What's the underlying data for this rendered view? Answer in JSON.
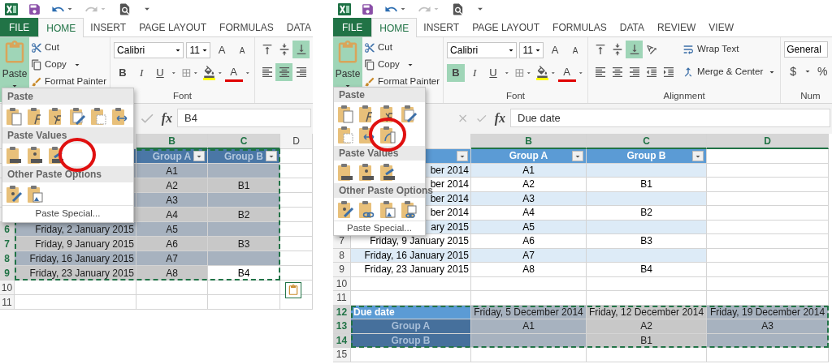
{
  "panels": [
    {
      "tabs": [
        {
          "label": "FILE",
          "kind": "file",
          "selected": false
        },
        {
          "label": "HOME",
          "kind": "tab",
          "selected": true
        },
        {
          "label": "INSERT",
          "kind": "tab",
          "selected": false
        },
        {
          "label": "PAGE LAYOUT",
          "kind": "tab",
          "selected": false
        },
        {
          "label": "FORMULAS",
          "kind": "tab",
          "selected": false
        },
        {
          "label": "DATA",
          "kind": "tab",
          "selected": false
        }
      ],
      "ribbon": {
        "clipboard": {
          "paste": "Paste",
          "paste_open": true,
          "cut": "Cut",
          "copy": "Copy",
          "format_painter": "Format Painter"
        },
        "font": {
          "name": "Calibri",
          "size": "11",
          "grow": "A",
          "shrink": "A",
          "bold": "B",
          "bold_on": false,
          "italic": "I",
          "underline": "U",
          "font_color": "A",
          "label": "Font"
        },
        "alignment": {
          "rows": [
            [
              {
                "kind": "top",
                "selected": false
              },
              {
                "kind": "middle",
                "selected": false
              },
              {
                "kind": "bottom",
                "selected": true
              }
            ],
            [
              {
                "kind": "left",
                "selected": false
              },
              {
                "kind": "center",
                "selected": true
              },
              {
                "kind": "right",
                "selected": false
              }
            ]
          ]
        }
      },
      "paste_menu": {
        "sections": [
          {
            "title": "Paste",
            "items": [
              {
                "kind": "all",
                "circled": false
              },
              {
                "kind": "formulas",
                "circled": false
              },
              {
                "kind": "formulas-number",
                "circled": false
              },
              {
                "kind": "keep-source",
                "circled": false
              },
              {
                "kind": "no-borders",
                "circled": false
              },
              {
                "kind": "keep-widths",
                "circled": false
              }
            ]
          },
          {
            "title": "Paste Values",
            "circled_gap": true,
            "items": [
              {
                "kind": "values",
                "circled": false
              },
              {
                "kind": "values-number",
                "circled": false
              },
              {
                "kind": "values-source",
                "circled": false
              }
            ]
          },
          {
            "title": "Other Paste Options",
            "items": [
              {
                "kind": "formatting",
                "circled": false
              },
              {
                "kind": "picture",
                "circled": false
              }
            ]
          }
        ],
        "footer": "Paste Special..."
      },
      "formula_bar": {
        "buttons": [
          {
            "kind": "enter"
          },
          {
            "kind": "function",
            "label": "fx"
          }
        ],
        "value": "B4"
      },
      "grid": {
        "columns": [
          {
            "label": "B",
            "highlighted": true
          },
          {
            "label": "C",
            "highlighted": true
          },
          {
            "label": "D",
            "highlighted": false
          }
        ],
        "paste_options_button": true,
        "sections": [
          {
            "copied": true,
            "rows": [
              {
                "cells": [
                  {
                    "kind": "sel-header"
                  },
                  {
                    "kind": "sel-header",
                    "text": "Group A",
                    "filter": true
                  },
                  {
                    "kind": "sel-header",
                    "text": "Group B",
                    "filter": true
                  }
                ],
                "outside": [
                  {
                    "kind": "empty"
                  }
                ]
              },
              {
                "cells": [
                  {
                    "kind": "sel-band"
                  },
                  {
                    "kind": "sel-band",
                    "text": "A1"
                  },
                  {
                    "kind": "sel-band"
                  }
                ],
                "outside": [
                  {
                    "kind": "empty"
                  }
                ]
              },
              {
                "cells": [
                  {
                    "kind": "sel-plain"
                  },
                  {
                    "kind": "sel-plain",
                    "text": "A2"
                  },
                  {
                    "kind": "sel-plain",
                    "text": "B1"
                  }
                ],
                "outside": [
                  {
                    "kind": "empty"
                  }
                ]
              },
              {
                "cells": [
                  {
                    "kind": "sel-band"
                  },
                  {
                    "kind": "sel-band",
                    "text": "A3"
                  },
                  {
                    "kind": "sel-band"
                  }
                ],
                "outside": [
                  {
                    "kind": "empty"
                  }
                ]
              },
              {
                "cells": [
                  {
                    "kind": "sel-plain"
                  },
                  {
                    "kind": "sel-plain",
                    "text": "A4"
                  },
                  {
                    "kind": "sel-plain",
                    "text": "B2"
                  }
                ],
                "outside": [
                  {
                    "kind": "empty"
                  }
                ]
              },
              {
                "number": "6",
                "highlighted": true,
                "cells": [
                  {
                    "kind": "sel-band",
                    "text": "Friday, 2 January 2015"
                  },
                  {
                    "kind": "sel-band",
                    "text": "A5"
                  },
                  {
                    "kind": "sel-band"
                  }
                ],
                "outside": [
                  {
                    "kind": "empty"
                  }
                ]
              },
              {
                "number": "7",
                "highlighted": true,
                "cells": [
                  {
                    "kind": "sel-plain",
                    "text": "Friday, 9 January 2015"
                  },
                  {
                    "kind": "sel-plain",
                    "text": "A6"
                  },
                  {
                    "kind": "sel-plain",
                    "text": "B3"
                  }
                ],
                "outside": [
                  {
                    "kind": "empty"
                  }
                ]
              },
              {
                "number": "8",
                "highlighted": true,
                "cells": [
                  {
                    "kind": "sel-band",
                    "text": "Friday, 16 January 2015"
                  },
                  {
                    "kind": "sel-band",
                    "text": "A7"
                  },
                  {
                    "kind": "sel-band"
                  }
                ],
                "outside": [
                  {
                    "kind": "empty"
                  }
                ]
              },
              {
                "number": "9",
                "highlighted": true,
                "cells": [
                  {
                    "kind": "sel-plain",
                    "text": "Friday, 23 January 2015"
                  },
                  {
                    "kind": "sel-plain",
                    "text": "A8"
                  },
                  {
                    "kind": "active",
                    "text": "B4"
                  }
                ],
                "outside": [
                  {
                    "kind": "empty"
                  }
                ]
              }
            ]
          },
          {
            "copied": false,
            "rows": [
              {
                "number": "10",
                "highlighted": false,
                "cells": [
                  {
                    "kind": "empty"
                  },
                  {
                    "kind": "empty"
                  },
                  {
                    "kind": "empty"
                  },
                  {
                    "kind": "empty"
                  }
                ]
              },
              {
                "number": "11",
                "highlighted": false,
                "cells": [
                  {
                    "kind": "empty"
                  },
                  {
                    "kind": "empty"
                  },
                  {
                    "kind": "empty"
                  },
                  {
                    "kind": "empty"
                  }
                ]
              }
            ]
          }
        ]
      }
    },
    {
      "tabs": [
        {
          "label": "FILE",
          "kind": "file",
          "selected": false
        },
        {
          "label": "HOME",
          "kind": "tab",
          "selected": true
        },
        {
          "label": "INSERT",
          "kind": "tab",
          "selected": false
        },
        {
          "label": "PAGE LAYOUT",
          "kind": "tab",
          "selected": false
        },
        {
          "label": "FORMULAS",
          "kind": "tab",
          "selected": false
        },
        {
          "label": "DATA",
          "kind": "tab",
          "selected": false
        },
        {
          "label": "REVIEW",
          "kind": "tab",
          "selected": false
        },
        {
          "label": "VIEW",
          "kind": "tab",
          "selected": false
        }
      ],
      "ribbon": {
        "clipboard": {
          "paste": "Paste",
          "paste_open": true,
          "cut": "Cut",
          "copy": "Copy",
          "format_painter": "Format Painter"
        },
        "font": {
          "name": "Calibri",
          "size": "11",
          "grow": "A",
          "shrink": "A",
          "bold": "B",
          "bold_on": true,
          "italic": "I",
          "underline": "U",
          "font_color": "A",
          "label": "Font"
        },
        "alignment": {
          "rows": [
            [
              {
                "kind": "top",
                "selected": false
              },
              {
                "kind": "middle",
                "selected": false
              },
              {
                "kind": "bottom",
                "selected": true
              },
              {
                "kind": "orientation",
                "selected": false
              }
            ],
            [
              {
                "kind": "left",
                "selected": false
              },
              {
                "kind": "center",
                "selected": false
              },
              {
                "kind": "right",
                "selected": false
              },
              {
                "kind": "indent-less",
                "selected": false
              },
              {
                "kind": "indent-more",
                "selected": false
              }
            ]
          ],
          "wrap_text": "Wrap Text",
          "merge_center": "Merge & Center",
          "label": "Alignment"
        },
        "number": {
          "format": "General",
          "currency": "$",
          "percent": "%",
          "label": "Num"
        }
      },
      "paste_menu": {
        "sections": [
          {
            "title": "Paste",
            "items": [
              {
                "kind": "all",
                "circled": false
              },
              {
                "kind": "formulas",
                "circled": false
              },
              {
                "kind": "formulas-number",
                "circled": false
              },
              {
                "kind": "keep-source",
                "circled": false
              },
              {
                "kind": "no-borders",
                "circled": false
              },
              {
                "kind": "keep-widths",
                "circled": false
              },
              {
                "kind": "transpose",
                "circled": true
              }
            ]
          },
          {
            "title": "Paste Values",
            "items": [
              {
                "kind": "values",
                "circled": false
              },
              {
                "kind": "values-number",
                "circled": false
              },
              {
                "kind": "values-source",
                "circled": false
              }
            ]
          },
          {
            "title": "Other Paste Options",
            "items": [
              {
                "kind": "formatting",
                "circled": false
              },
              {
                "kind": "link",
                "circled": false
              },
              {
                "kind": "picture",
                "circled": false
              },
              {
                "kind": "linked-picture",
                "circled": false
              }
            ]
          }
        ],
        "footer": "Paste Special..."
      },
      "formula_bar": {
        "buttons": [
          {
            "kind": "cancel"
          },
          {
            "kind": "enter"
          },
          {
            "kind": "function",
            "label": "fx"
          }
        ],
        "value": "Due date"
      },
      "grid": {
        "columns": [
          {
            "label": "B",
            "highlighted": true
          },
          {
            "label": "C",
            "highlighted": true
          },
          {
            "label": "D",
            "highlighted": true
          }
        ],
        "paste_options_button": false,
        "sections": [
          {
            "copied": false,
            "rows": [
              {
                "cells": [
                  {
                    "kind": "header",
                    "filter": true
                  },
                  {
                    "kind": "header",
                    "text": "Group A",
                    "filter": true
                  },
                  {
                    "kind": "header",
                    "text": "Group B",
                    "filter": true
                  },
                  {
                    "kind": "empty"
                  }
                ]
              },
              {
                "cells": [
                  {
                    "kind": "band",
                    "text": "ber 2014"
                  },
                  {
                    "kind": "band",
                    "text": "A1"
                  },
                  {
                    "kind": "band"
                  },
                  {
                    "kind": "empty"
                  }
                ]
              },
              {
                "cells": [
                  {
                    "kind": "plain",
                    "text": "ber 2014"
                  },
                  {
                    "kind": "plain",
                    "text": "A2"
                  },
                  {
                    "kind": "plain",
                    "text": "B1"
                  },
                  {
                    "kind": "empty"
                  }
                ]
              },
              {
                "cells": [
                  {
                    "kind": "band",
                    "text": "ber 2014"
                  },
                  {
                    "kind": "band",
                    "text": "A3"
                  },
                  {
                    "kind": "band"
                  },
                  {
                    "kind": "empty"
                  }
                ]
              },
              {
                "cells": [
                  {
                    "kind": "plain",
                    "text": "ber 2014"
                  },
                  {
                    "kind": "plain",
                    "text": "A4"
                  },
                  {
                    "kind": "plain",
                    "text": "B2"
                  },
                  {
                    "kind": "empty"
                  }
                ]
              },
              {
                "cells": [
                  {
                    "kind": "band",
                    "text": "ary 2015"
                  },
                  {
                    "kind": "band",
                    "text": "A5"
                  },
                  {
                    "kind": "band"
                  },
                  {
                    "kind": "empty"
                  }
                ]
              },
              {
                "number": "7",
                "highlighted": false,
                "cells": [
                  {
                    "kind": "plain",
                    "text": "Friday, 9 January 2015"
                  },
                  {
                    "kind": "plain",
                    "text": "A6"
                  },
                  {
                    "kind": "plain",
                    "text": "B3"
                  },
                  {
                    "kind": "empty"
                  }
                ]
              },
              {
                "number": "8",
                "highlighted": false,
                "cells": [
                  {
                    "kind": "band",
                    "text": "Friday, 16 January 2015"
                  },
                  {
                    "kind": "band",
                    "text": "A7"
                  },
                  {
                    "kind": "band"
                  },
                  {
                    "kind": "empty"
                  }
                ]
              },
              {
                "number": "9",
                "highlighted": false,
                "cells": [
                  {
                    "kind": "plain",
                    "text": "Friday, 23 January 2015"
                  },
                  {
                    "kind": "plain",
                    "text": "A8"
                  },
                  {
                    "kind": "plain",
                    "text": "B4"
                  },
                  {
                    "kind": "empty"
                  }
                ]
              },
              {
                "number": "10",
                "highlighted": false,
                "cells": [
                  {
                    "kind": "empty"
                  },
                  {
                    "kind": "empty"
                  },
                  {
                    "kind": "empty"
                  },
                  {
                    "kind": "empty"
                  }
                ]
              },
              {
                "number": "11",
                "highlighted": false,
                "cells": [
                  {
                    "kind": "empty"
                  },
                  {
                    "kind": "empty"
                  },
                  {
                    "kind": "empty"
                  },
                  {
                    "kind": "empty"
                  }
                ]
              }
            ]
          },
          {
            "copied": true,
            "rows": [
              {
                "number": "12",
                "highlighted": true,
                "cells": [
                  {
                    "kind": "title",
                    "text": "Due date"
                  },
                  {
                    "kind": "sel-band",
                    "text": "Friday, 5 December 2014"
                  },
                  {
                    "kind": "sel-plain",
                    "text": "Friday, 12 December 2014"
                  },
                  {
                    "kind": "sel-band",
                    "text": "Friday, 19 December 2014"
                  }
                ]
              },
              {
                "number": "13",
                "highlighted": true,
                "cells": [
                  {
                    "kind": "sel-dark",
                    "text": "Group A"
                  },
                  {
                    "kind": "sel-band",
                    "text": "A1"
                  },
                  {
                    "kind": "sel-plain",
                    "text": "A2"
                  },
                  {
                    "kind": "sel-band",
                    "text": "A3"
                  }
                ]
              },
              {
                "number": "14",
                "highlighted": true,
                "cells": [
                  {
                    "kind": "sel-dark",
                    "text": "Group B"
                  },
                  {
                    "kind": "sel-band"
                  },
                  {
                    "kind": "sel-plain",
                    "text": "B1"
                  },
                  {
                    "kind": "sel-band"
                  }
                ]
              }
            ]
          },
          {
            "copied": false,
            "rows": [
              {
                "number": "15",
                "highlighted": false,
                "cells": [
                  {
                    "kind": "empty"
                  },
                  {
                    "kind": "empty"
                  },
                  {
                    "kind": "empty"
                  },
                  {
                    "kind": "empty"
                  }
                ]
              }
            ]
          }
        ]
      }
    }
  ]
}
